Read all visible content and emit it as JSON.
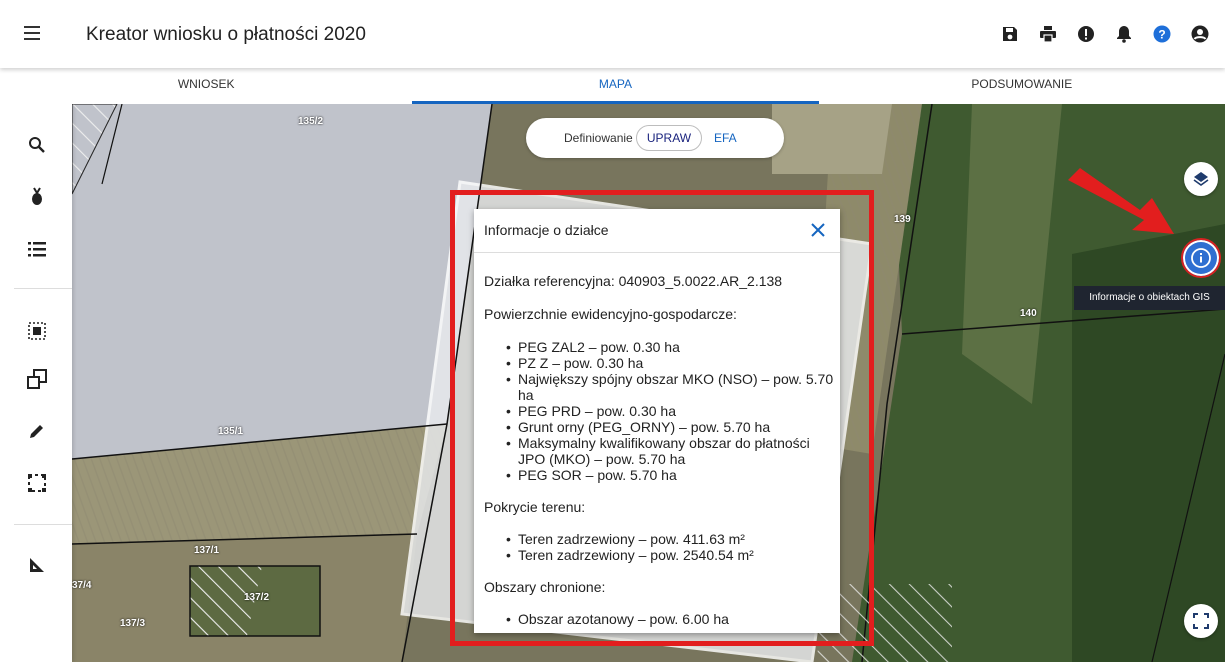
{
  "app": {
    "title": "Kreator wniosku o płatności 2020"
  },
  "header_icons": [
    "save-icon",
    "print-icon",
    "alert-icon",
    "bell-icon",
    "help-icon",
    "account-icon"
  ],
  "tabs": [
    {
      "label": "WNIOSEK",
      "active": false
    },
    {
      "label": "MAPA",
      "active": true
    },
    {
      "label": "PODSUMOWANIE",
      "active": false
    }
  ],
  "left_toolbar": [
    "search-icon",
    "plant-icon",
    "list-icon",
    "select-area-icon",
    "copy-geometry-icon",
    "edit-pencil-icon",
    "selection-frame-icon",
    "measure-icon"
  ],
  "definition_toggle": {
    "label": "Definiowanie",
    "option_selected": "UPRAW",
    "option_other": "EFA"
  },
  "parcel_labels": [
    "135/2",
    "139",
    "140",
    "135/1",
    "137/1",
    "37/4",
    "137/2",
    "137/3"
  ],
  "map_controls": {
    "tooltip": "Informacje o obiektach GIS"
  },
  "info_dialog": {
    "title": "Informacje o działce",
    "reference_parcel": "Działka referencyjna: 040903_5.0022.AR_2.138",
    "sections": [
      {
        "heading": "Powierzchnie ewidencyjno-gospodarcze:",
        "items": [
          "PEG ZAL2 – pow. 0.30 ha",
          "PZ Z – pow. 0.30 ha",
          "Największy spójny obszar MKO (NSO) – pow. 5.70 ha",
          "PEG PRD – pow. 0.30 ha",
          "Grunt orny (PEG_ORNY) – pow. 5.70 ha",
          "Maksymalny kwalifikowany obszar do płatności JPO (MKO) – pow. 5.70 ha",
          "PEG SOR – pow. 5.70 ha"
        ]
      },
      {
        "heading": "Pokrycie terenu:",
        "items": [
          "Teren zadrzewiony – pow. 411.63 m²",
          "Teren zadrzewiony – pow. 2540.54 m²"
        ]
      },
      {
        "heading": "Obszary chronione:",
        "items": [
          "Obszar azotanowy – pow. 6.00 ha"
        ]
      }
    ]
  },
  "colors": {
    "accent": "#1565c0",
    "highlight": "#e21e1e",
    "info_button": "#2f6fd1"
  }
}
